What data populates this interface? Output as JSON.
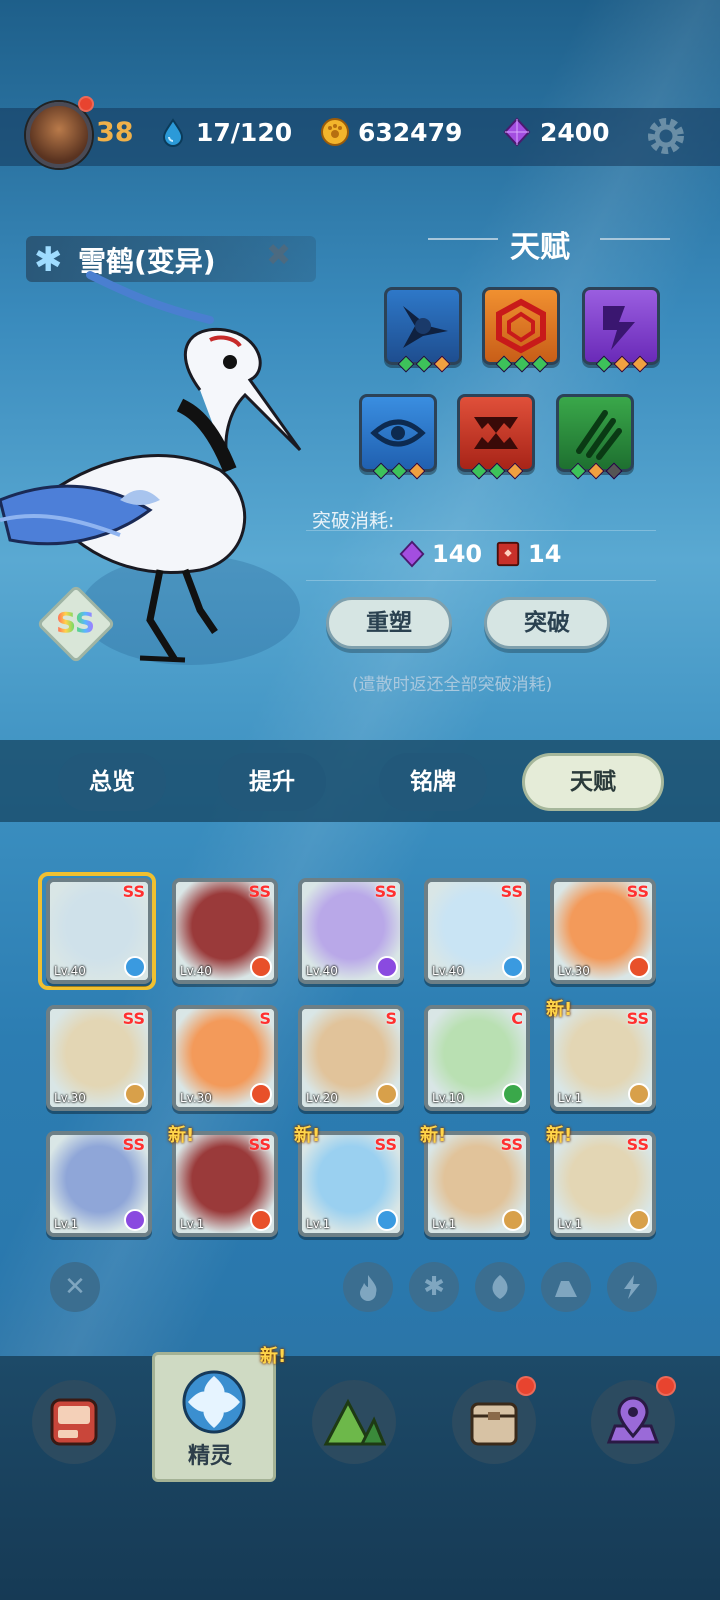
{
  "topbar": {
    "level": "38",
    "energy": "17/120",
    "coins": "632479",
    "gems": "2400"
  },
  "hero": {
    "name": "雪鹤(变异)",
    "grade": "SS"
  },
  "talent": {
    "title": "天赋",
    "cost_label": "突破消耗:",
    "cost_gems": "140",
    "cost_books": "14",
    "reshape_label": "重塑",
    "breakthrough_label": "突破",
    "note": "(遣散时返还全部突破消耗)"
  },
  "tabs": [
    "总览",
    "提升",
    "铭牌",
    "天赋"
  ],
  "active_tab": "天赋",
  "roster": [
    {
      "lv": "Lv.40",
      "grade": "SS",
      "element": "ice"
    },
    {
      "lv": "Lv.40",
      "grade": "SS",
      "element": "fire"
    },
    {
      "lv": "Lv.40",
      "grade": "SS",
      "element": "electric"
    },
    {
      "lv": "Lv.40",
      "grade": "SS",
      "element": "ice"
    },
    {
      "lv": "Lv.30",
      "grade": "SS",
      "element": "fire"
    },
    {
      "lv": "Lv.30",
      "grade": "SS",
      "element": "earth"
    },
    {
      "lv": "Lv.30",
      "grade": "S",
      "element": "fire"
    },
    {
      "lv": "Lv.20",
      "grade": "S",
      "element": "earth"
    },
    {
      "lv": "Lv.10",
      "grade": "C",
      "element": "grass"
    },
    {
      "lv": "Lv.1",
      "grade": "SS",
      "element": "earth",
      "new": "新!"
    },
    {
      "lv": "Lv.1",
      "grade": "SS",
      "element": "electric"
    },
    {
      "lv": "Lv.1",
      "grade": "SS",
      "element": "fire",
      "new": "新!"
    },
    {
      "lv": "Lv.1",
      "grade": "SS",
      "element": "ice",
      "new": "新!"
    },
    {
      "lv": "Lv.1",
      "grade": "SS",
      "element": "earth",
      "new": "新!"
    },
    {
      "lv": "Lv.1",
      "grade": "SS",
      "element": "earth",
      "new": "新!"
    }
  ],
  "bottom_nav": {
    "active_label": "精灵",
    "new_tag": "新!"
  },
  "colors": {
    "accent_gold": "#f0b14a",
    "badge_red": "#e8442f",
    "grade_red": "#ff3030",
    "new_yellow": "#ffd54a"
  }
}
